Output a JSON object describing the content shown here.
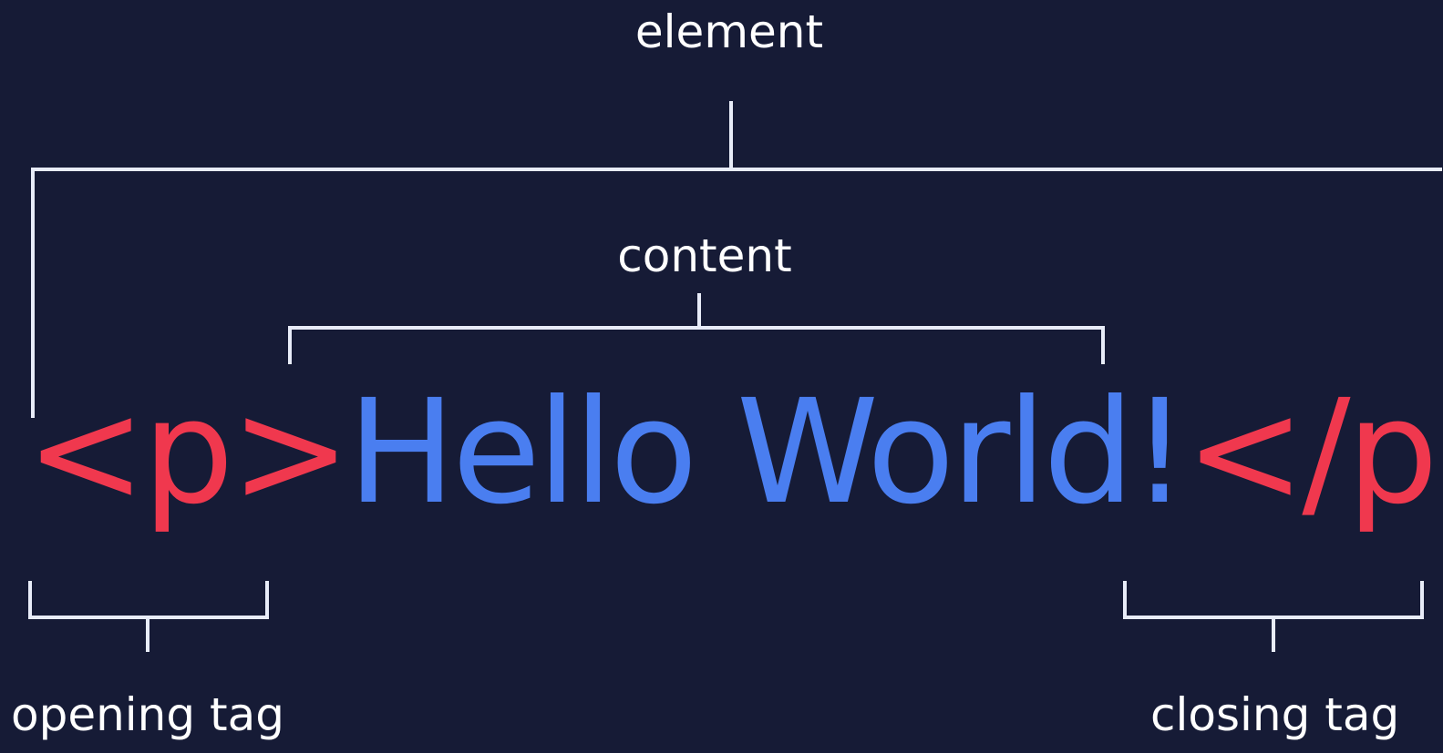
{
  "labels": {
    "element": "element",
    "content": "content",
    "opening_tag": "opening tag",
    "closing_tag": "closing tag"
  },
  "code": {
    "opening_tag": "<p>",
    "content": "Hello World!",
    "closing_tag": "</p>"
  },
  "colors": {
    "background": "#161b36",
    "tag": "#f0384e",
    "content": "#4a7ef0",
    "label": "#ffffff",
    "bracket": "#e8ecf8"
  }
}
